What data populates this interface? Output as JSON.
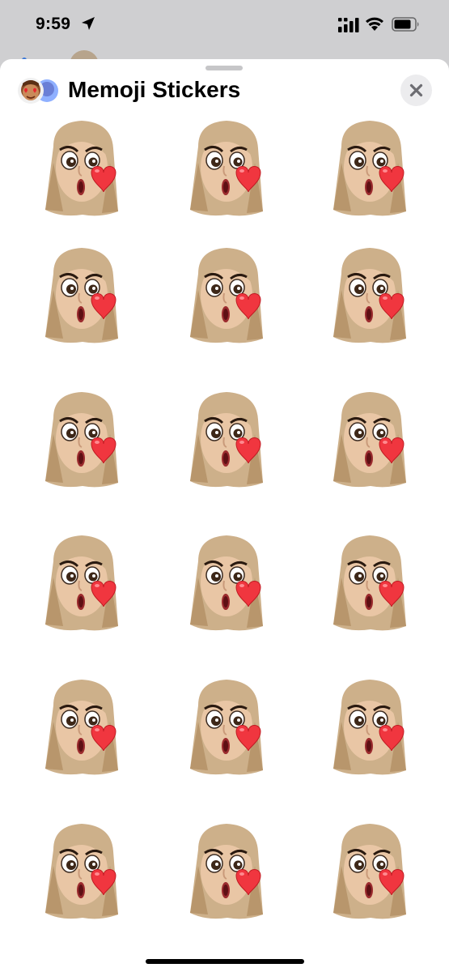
{
  "status_bar": {
    "time": "9:59"
  },
  "sheet": {
    "title": "Memoji Stickers"
  },
  "stickers": {
    "columns": 3,
    "rows": 6,
    "item_name": "memoji-sticker",
    "accent_heart": "#f0363f",
    "hair": "#cdb08a",
    "skin": "#e9c6a5"
  }
}
